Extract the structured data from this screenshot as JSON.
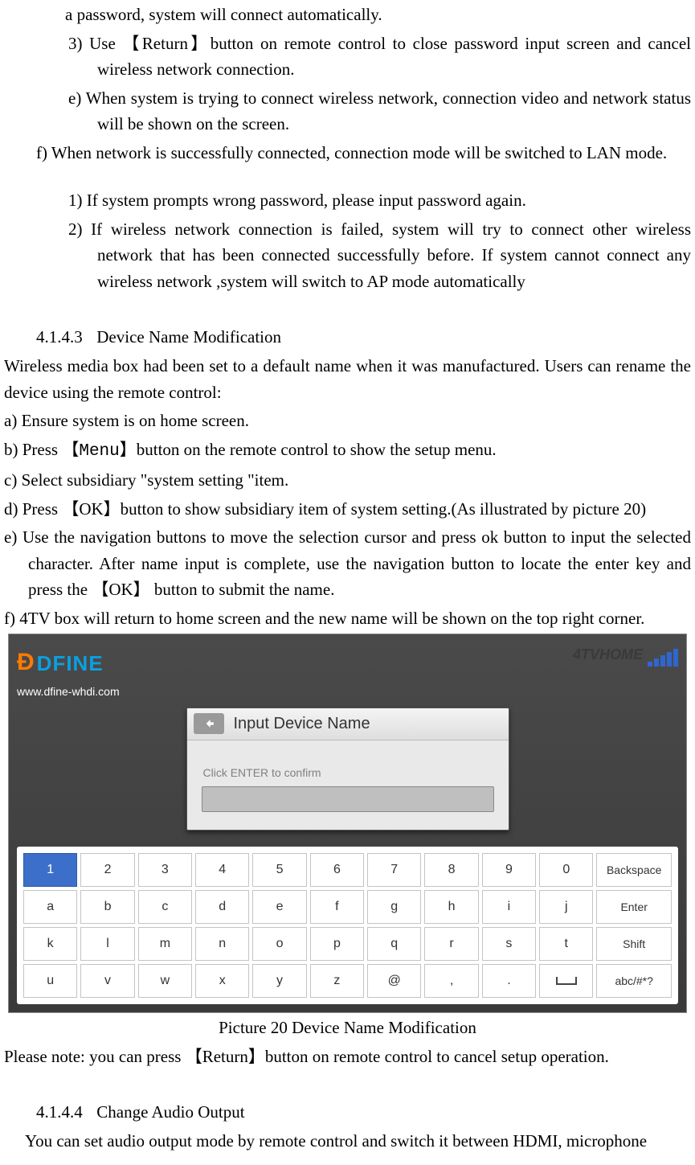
{
  "body": {
    "p_line0": "a password, system will connect automatically.",
    "p_3": "3)   Use 【Return】button on remote control to close password input screen and cancel wireless network connection.",
    "p_e": "e)   When system is trying to connect wireless network, connection video and network status will be shown on the screen.",
    "p_f": "f)   When network is successfully connected, connection mode will be switched to LAN mode.",
    "p_n1": "1)   If system prompts wrong password, please input password again.",
    "p_n2": "2)   If wireless network connection is failed, system will try to connect other wireless network that has been connected successfully before. If system cannot connect any wireless network ,system will switch to AP mode automatically",
    "sec3_num": "4.1.4.3",
    "sec3_title": "Device Name Modification",
    "sec3_intro": "Wireless media box had been set to a default name when it was manufactured. Users can rename the device using the remote control:",
    "sec3_a": "a)   Ensure system is on home screen.",
    "sec3_b_pre": "b)   Press 【",
    "sec3_b_menu": "Menu",
    "sec3_b_post": "】button on the remote control to show the setup menu.",
    "sec3_c": "c)   Select subsidiary \"system setting \"item.",
    "sec3_d": "d)   Press 【OK】button to show subsidiary item of system setting.(As illustrated by picture 20)",
    "sec3_e": "e)   Use the navigation buttons to move the selection cursor and press ok button to input the selected character. After name input is complete, use the navigation button to locate the enter key and press the 【OK】 button to submit the name.",
    "sec3_f": "f)   4TV box will return to home screen and the new name will be shown on the top right corner.",
    "caption20": "Picture 20 Device Name Modification",
    "note": "Please note: you can press 【Return】button on remote control to cancel setup operation.",
    "sec4_num": "4.1.4.4",
    "sec4_title": "Change Audio Output",
    "sec4_intro": "You can set audio output mode by remote control and switch it between HDMI, microphone"
  },
  "figure": {
    "logo_text": "DFINE",
    "logo_url": "www.dfine-whdi.com",
    "status_label": "4TVHOME",
    "popup_title": "Input Device Name",
    "popup_hint": "Click ENTER to confirm",
    "input_value": "",
    "keyboard": {
      "rows": [
        [
          "1",
          "2",
          "3",
          "4",
          "5",
          "6",
          "7",
          "8",
          "9",
          "0",
          "Backspace"
        ],
        [
          "a",
          "b",
          "c",
          "d",
          "e",
          "f",
          "g",
          "h",
          "i",
          "j",
          "Enter"
        ],
        [
          "k",
          "l",
          "m",
          "n",
          "o",
          "p",
          "q",
          "r",
          "s",
          "t",
          "Shift"
        ],
        [
          "u",
          "v",
          "w",
          "x",
          "y",
          "z",
          "@",
          ",",
          ".",
          "␣",
          "abc/#*?"
        ]
      ],
      "selected": "1"
    }
  }
}
